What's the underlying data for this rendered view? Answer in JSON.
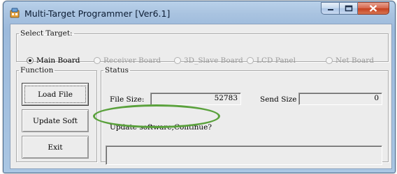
{
  "window": {
    "title": "Multi-Target Programmer [Ver6.1]"
  },
  "select_target": {
    "legend": "Select Target:",
    "options": [
      {
        "label": "Main Board",
        "selected": true
      },
      {
        "label": "Receiver Board",
        "selected": false
      },
      {
        "label": "3D_Slave Board",
        "selected": false
      },
      {
        "label": "LCD Panel",
        "selected": false
      },
      {
        "label": "Net Board",
        "selected": false
      }
    ]
  },
  "function": {
    "legend": "Function",
    "buttons": [
      "Load File",
      "Update Soft",
      "Exit"
    ]
  },
  "status": {
    "legend": "Status",
    "file_size_label": "File Size:",
    "file_size_value": "52783",
    "send_size_label": "Send Size",
    "send_size_value": "0",
    "message": "Update software,Continue?",
    "message_box_value": ""
  },
  "colors": {
    "title_bar": "#a9c3e0",
    "close_button": "#c6401f",
    "highlight_ellipse": "#5aa13c"
  },
  "icons": [
    "app-icon",
    "minimize-icon",
    "maximize-icon",
    "close-icon"
  ]
}
